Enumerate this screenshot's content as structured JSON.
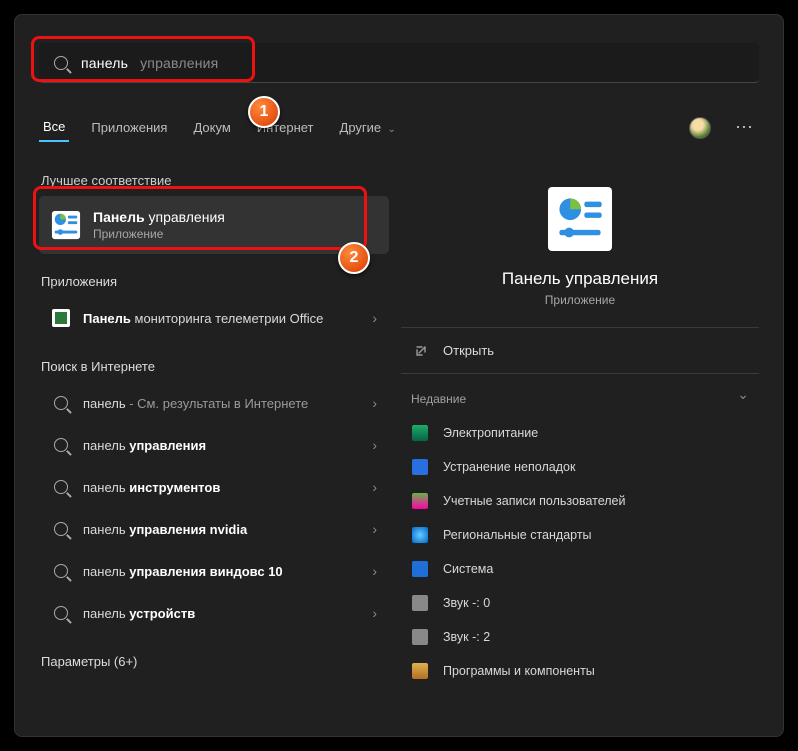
{
  "search": {
    "typed": "панель",
    "suggestion": "управления"
  },
  "tabs": {
    "all": "Все",
    "apps": "Приложения",
    "docs": "Докум",
    "web": "Интернет",
    "more": "Другие"
  },
  "left": {
    "best_label": "Лучшее соответствие",
    "best": {
      "title_bold": "Панель",
      "title_rest": " управления",
      "sub": "Приложение"
    },
    "apps_label": "Приложения",
    "app_row": {
      "bold": "Панель",
      "rest": " мониторинга телеметрии Office"
    },
    "web_label": "Поиск в Интернете",
    "web_rows": [
      {
        "pre": "панель",
        "post": " - См. результаты в Интернете",
        "bold": ""
      },
      {
        "pre": "панель ",
        "bold": "управления",
        "post": ""
      },
      {
        "pre": "панель ",
        "bold": "инструментов",
        "post": ""
      },
      {
        "pre": "панель ",
        "bold": "управления nvidia",
        "post": ""
      },
      {
        "pre": "панель ",
        "bold": "управления виндовс 10",
        "post": ""
      },
      {
        "pre": "панель ",
        "bold": "устройств",
        "post": ""
      }
    ],
    "settings_label": "Параметры (6+)"
  },
  "right": {
    "title": "Панель управления",
    "sub": "Приложение",
    "open": "Открыть",
    "recent_label": "Недавние",
    "recent": [
      "Электропитание",
      "Устранение неполадок",
      "Учетные записи пользователей",
      "Региональные стандарты",
      "Система",
      "Звук -: 0",
      "Звук -: 2",
      "Программы и компоненты"
    ]
  },
  "annotations": {
    "m1": "1",
    "m2": "2"
  }
}
